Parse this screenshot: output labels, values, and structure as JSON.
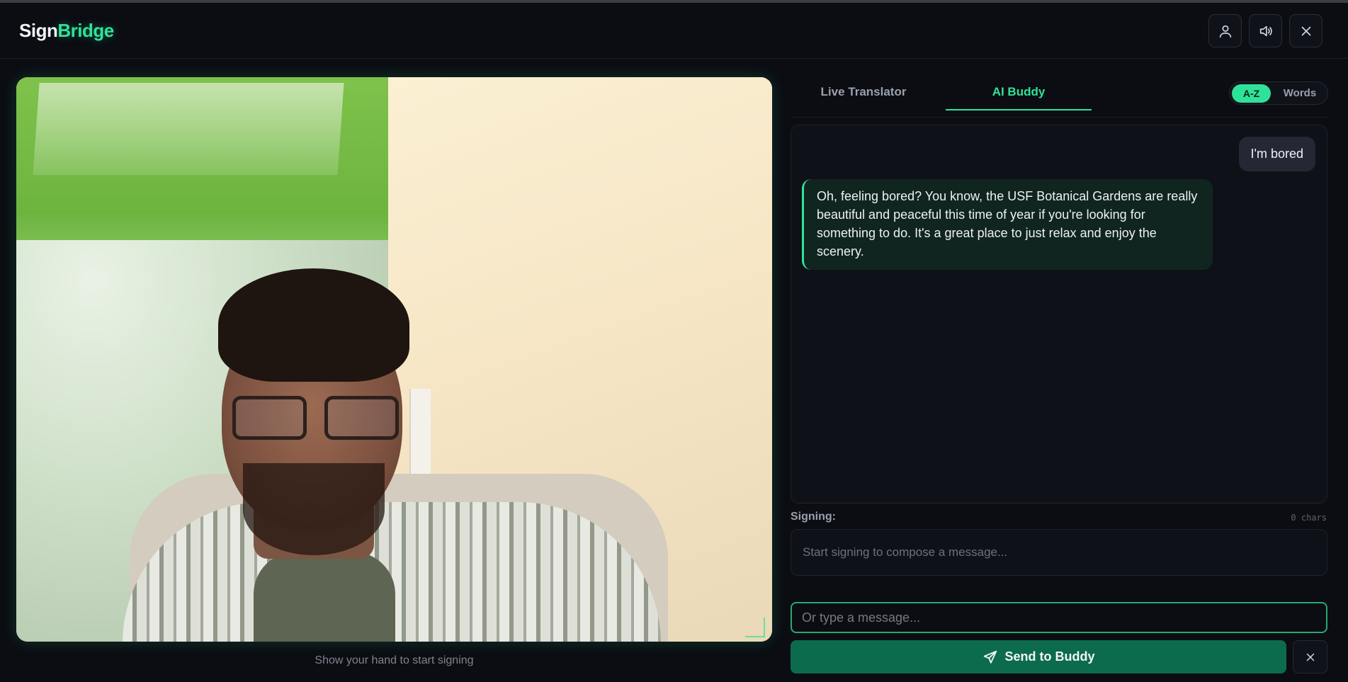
{
  "app": {
    "logo_part1": "Sign",
    "logo_part2": "Bridge"
  },
  "header": {
    "icons": [
      "user-icon",
      "speaker-icon",
      "close-icon"
    ]
  },
  "video": {
    "hint": "Show your hand to start signing"
  },
  "tabs": [
    {
      "label": "Live Translator",
      "active": false
    },
    {
      "label": "AI Buddy",
      "active": true
    }
  ],
  "mode_toggle": {
    "az": "A-Z",
    "words": "Words",
    "selected": "A-Z"
  },
  "chat": {
    "messages": [
      {
        "role": "user",
        "text": "I'm bored"
      },
      {
        "role": "assistant",
        "text": "Oh, feeling bored? You know, the USF Botanical Gardens are really beautiful and peaceful this time of year if you're looking for something to do. It's a great place to just relax and enjoy the scenery."
      }
    ]
  },
  "signing": {
    "label": "Signing:",
    "count": "0 chars",
    "placeholder": "Start signing to compose a message..."
  },
  "compose": {
    "placeholder": "Or type a message...",
    "value": ""
  },
  "actions": {
    "send_label": "Send to Buddy"
  },
  "colors": {
    "accent": "#2fe29a",
    "background": "#0b0d12",
    "send_button": "#0c6b4c"
  }
}
